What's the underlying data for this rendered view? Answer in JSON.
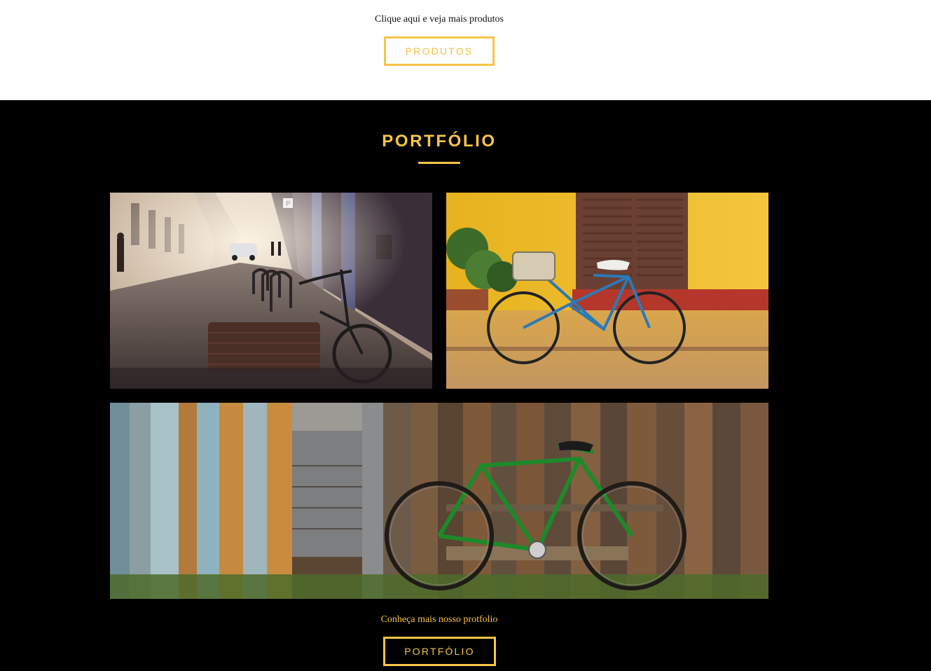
{
  "products": {
    "text": "Clique aqui e veja mais produtos",
    "button_label": "PRODUTOS"
  },
  "portfolio": {
    "title": "PORTFÓLIO",
    "photos": [
      {
        "icon": "street-bicycle-photo"
      },
      {
        "icon": "yellow-wall-bicycle-photo"
      },
      {
        "icon": "wooden-fence-green-bicycle-photo"
      }
    ],
    "text": "Conheça mais nosso protfolio",
    "button_label": "PORTFÓLIO"
  },
  "colors": {
    "accent": "#f7c548",
    "section_bg": "#000000",
    "page_bg": "#ffffff"
  }
}
